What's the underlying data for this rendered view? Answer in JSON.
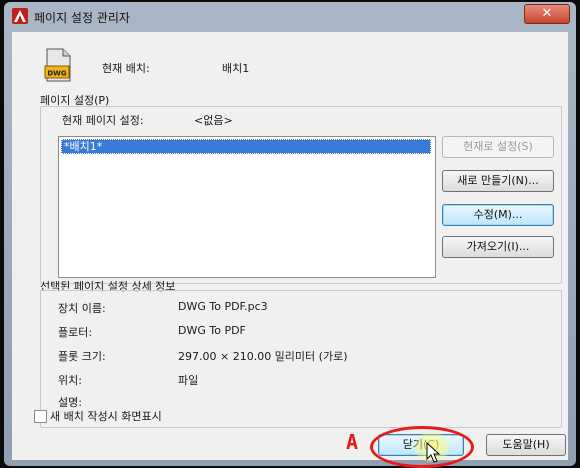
{
  "window": {
    "title": "페이지 설정 관리자",
    "close_glyph": "✕"
  },
  "current_layout": {
    "label": "현재 배치:",
    "value": "배치1"
  },
  "page_setups": {
    "group_label": "페이지 설정(P)",
    "current_label": "현재 페이지 설정:",
    "current_value": "<없음>",
    "list_items": [
      "*배치1*"
    ],
    "buttons": {
      "set_current": "현재로 설정(S)",
      "new": "새로 만들기(N)...",
      "modify": "수정(M)...",
      "import": "가져오기(I)..."
    }
  },
  "details": {
    "group_label": "선택된 페이지 설정 상세 정보",
    "rows": [
      {
        "label": "장치 이름:",
        "value": "DWG To PDF.pc3"
      },
      {
        "label": "플로터:",
        "value": "DWG To PDF"
      },
      {
        "label": "플롯 크기:",
        "value": "297.00 × 210.00 밀리미터 (가로)"
      },
      {
        "label": "위치:",
        "value": "파일"
      },
      {
        "label": "설명:",
        "value": ""
      }
    ]
  },
  "footer": {
    "checkbox_label": "새 배치 작성시 화면표시",
    "checkbox_checked": false,
    "close_button": "닫기(C)",
    "help_button": "도움말(H)"
  },
  "annotation": {
    "letter": "A"
  },
  "colors": {
    "selection": "#3a7bd5",
    "annotation": "#e81b1b",
    "close_button": "#c8442f"
  }
}
